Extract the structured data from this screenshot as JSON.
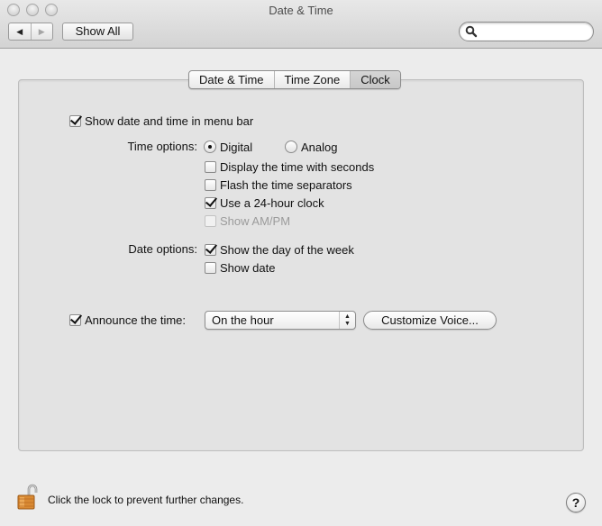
{
  "window": {
    "title": "Date & Time",
    "back_icon": "triangle-left",
    "forward_icon": "triangle-right",
    "show_all_label": "Show All",
    "search": {
      "value": "",
      "placeholder": "",
      "icon": "magnifier"
    }
  },
  "tabs": [
    {
      "label": "Date & Time",
      "active": false
    },
    {
      "label": "Time Zone",
      "active": false
    },
    {
      "label": "Clock",
      "active": true
    }
  ],
  "clock": {
    "show_in_menu_bar": {
      "label": "Show date and time in menu bar",
      "checked": true
    },
    "time_options": {
      "label": "Time options:",
      "radios": [
        {
          "label": "Digital",
          "selected": true
        },
        {
          "label": "Analog",
          "selected": false
        }
      ],
      "checkboxes": [
        {
          "label": "Display the time with seconds",
          "checked": false,
          "enabled": true
        },
        {
          "label": "Flash the time separators",
          "checked": false,
          "enabled": true
        },
        {
          "label": "Use a 24-hour clock",
          "checked": true,
          "enabled": true
        },
        {
          "label": "Show AM/PM",
          "checked": false,
          "enabled": false
        }
      ]
    },
    "date_options": {
      "label": "Date options:",
      "checkboxes": [
        {
          "label": "Show the day of the week",
          "checked": true
        },
        {
          "label": "Show date",
          "checked": false
        }
      ]
    },
    "announce": {
      "label": "Announce the time:",
      "checked": true,
      "selected": "On the hour",
      "customize_label": "Customize Voice..."
    }
  },
  "footer": {
    "lock_text": "Click the lock to prevent further changes.",
    "lock_state": "unlocked",
    "help_label": "?"
  }
}
